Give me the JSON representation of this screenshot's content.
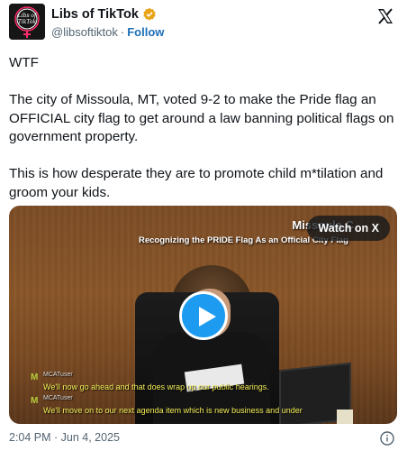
{
  "header": {
    "display_name": "Libs of TikTok",
    "handle": "@libsoftiktok",
    "separator": "·",
    "follow_label": "Follow",
    "avatar_text_1": "Libs of",
    "avatar_text_2": "TikTok"
  },
  "tweet": {
    "line1": "WTF",
    "paragraph2": "The city of Missoula, MT, voted 9-2 to make the Pride flag an OFFICIAL city flag to get around a law banning political flags on government property.",
    "paragraph3": "This is how desperate they are to promote child m*tilation and groom your kids."
  },
  "video": {
    "title": "Missoula C",
    "subtitle": "Recognizing the PRIDE Flag As an Official City Flag",
    "watch_label": "Watch on X",
    "captions": [
      {
        "user": "MCATuser",
        "text": "We'll now go ahead and that does wrap up our public hearings."
      },
      {
        "user": "MCATuser",
        "text": "We'll move on to our next agenda item which is new business and under"
      }
    ]
  },
  "footer": {
    "timestamp": "2:04 PM · Jun 4, 2025"
  },
  "colors": {
    "accent": "#1d9bf0",
    "verified": "#e8a317",
    "text_secondary": "#536471"
  }
}
